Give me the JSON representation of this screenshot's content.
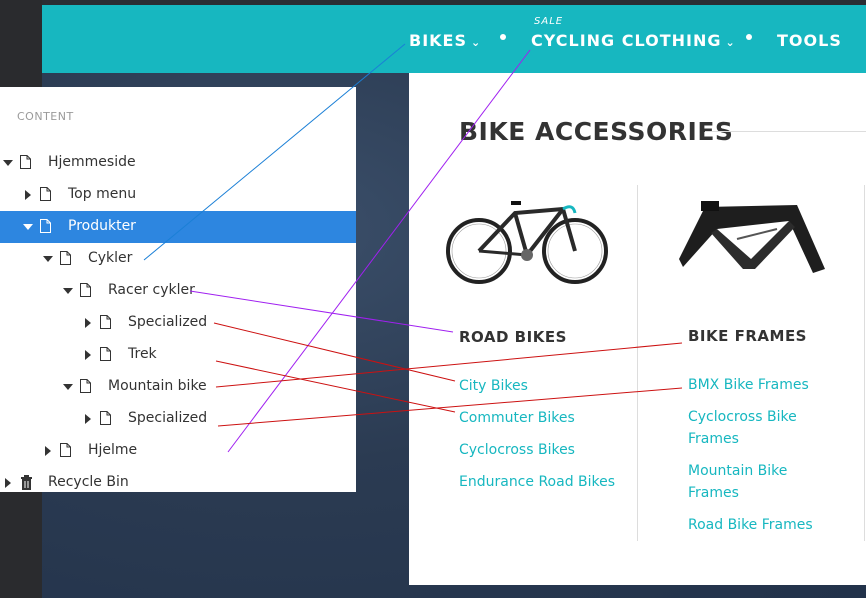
{
  "nav": {
    "items": [
      {
        "label": "BIKES",
        "has_dropdown": true
      },
      {
        "label": "CYCLING CLOTHING",
        "has_dropdown": true,
        "badge": "SALE"
      },
      {
        "label": "TOOLS",
        "has_dropdown": false
      }
    ],
    "color": "#17b7c0"
  },
  "content_panel": {
    "title": "BIKE ACCESSORIES",
    "columns": [
      {
        "heading": "ROAD BIKES",
        "image_icon": "road-bike-image",
        "links": [
          "City Bikes",
          "Commuter Bikes",
          "Cyclocross Bikes",
          "Endurance Road Bikes"
        ]
      },
      {
        "heading": "BIKE FRAMES",
        "image_icon": "bike-frame-image",
        "links": [
          "BMX Bike Frames",
          "Cyclocross Bike Frames",
          "Mountain Bike Frames",
          "Road Bike Frames"
        ]
      }
    ]
  },
  "tree": {
    "header": "CONTENT",
    "nodes": [
      {
        "label": "Hjemmeside",
        "level": 0,
        "caret": "down",
        "icon": "document-icon"
      },
      {
        "label": "Top menu",
        "level": 1,
        "caret": "right",
        "icon": "document-icon"
      },
      {
        "label": "Produkter",
        "level": 1,
        "caret": "down",
        "icon": "document-icon",
        "selected": true
      },
      {
        "label": "Cykler",
        "level": 2,
        "caret": "down",
        "icon": "document-icon"
      },
      {
        "label": "Racer cykler",
        "level": 3,
        "caret": "down",
        "icon": "document-icon"
      },
      {
        "label": "Specialized",
        "level": 4,
        "caret": "right",
        "icon": "document-icon"
      },
      {
        "label": "Trek",
        "level": 4,
        "caret": "right",
        "icon": "document-icon"
      },
      {
        "label": "Mountain bike",
        "level": 3,
        "caret": "down",
        "icon": "document-icon"
      },
      {
        "label": "Specialized",
        "level": 4,
        "caret": "right",
        "icon": "document-icon"
      },
      {
        "label": "Hjelme",
        "level": 2,
        "caret": "right",
        "icon": "document-icon"
      },
      {
        "label": "Recycle Bin",
        "level": 0,
        "caret": "right",
        "icon": "trash-icon"
      }
    ],
    "selected_color": "#2d86e0"
  },
  "connector_colors": {
    "blue": "#1a7fd6",
    "purple": "#a020f0",
    "red": "#cc1111"
  }
}
